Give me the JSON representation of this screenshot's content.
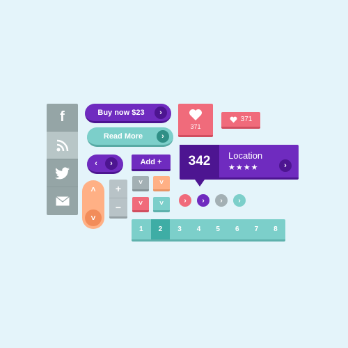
{
  "social": {
    "facebook_glyph": "f",
    "items": [
      "facebook-icon",
      "rss-icon",
      "twitter-icon",
      "mail-icon"
    ]
  },
  "buttons": {
    "buy_label": "Buy now $23",
    "read_label": "Read More",
    "add_label": "Add +",
    "chevron": "›",
    "prev": "‹",
    "next": "›"
  },
  "like": {
    "big_count": "371",
    "small_count": "371"
  },
  "location": {
    "count": "342",
    "label": "Location",
    "stars": "★★★★",
    "rating": 4
  },
  "stepper": {
    "plus": "+",
    "minus": "−"
  },
  "slider": {
    "up": "˄",
    "down": "˅"
  },
  "pagination": {
    "pages": [
      "1",
      "2",
      "3",
      "4",
      "5",
      "6",
      "7",
      "8"
    ],
    "active": "2"
  },
  "colors": {
    "background": "#e4f4fa",
    "purple": "#6f2bbf",
    "teal": "#7ccfca",
    "coral": "#f06b7b",
    "orange": "#ffb085",
    "gray": "#95a5a6"
  }
}
